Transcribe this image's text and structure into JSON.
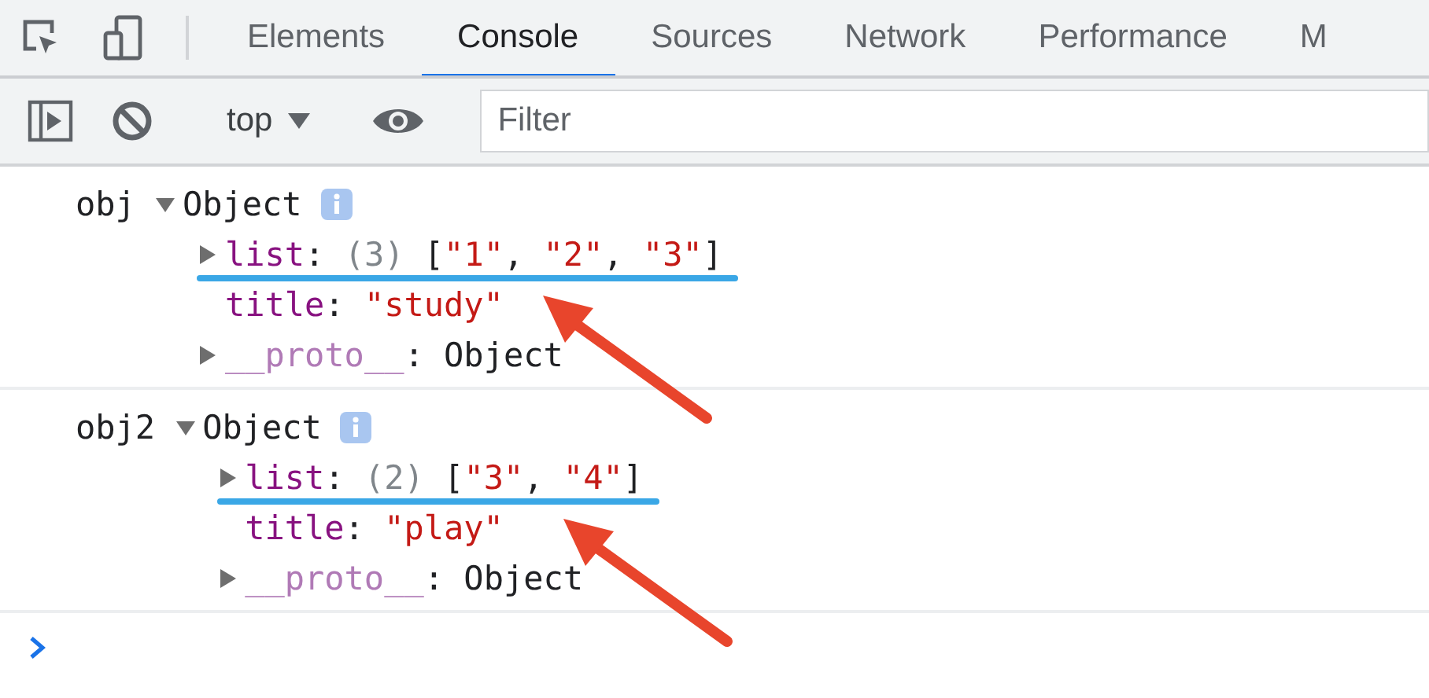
{
  "tabs": [
    {
      "label": "Elements",
      "selected": false
    },
    {
      "label": "Console",
      "selected": true
    },
    {
      "label": "Sources",
      "selected": false
    },
    {
      "label": "Network",
      "selected": false
    },
    {
      "label": "Performance",
      "selected": false
    },
    {
      "label": "M",
      "selected": false
    }
  ],
  "console_toolbar": {
    "context": "top",
    "filter": {
      "placeholder": "Filter"
    }
  },
  "entries": [
    {
      "name": "obj",
      "summary": "Object",
      "expanded": true,
      "properties": [
        {
          "expandable": true,
          "underlined": true,
          "arrow": false,
          "tokens": [
            {
              "text": "list",
              "kind": "key"
            },
            {
              "text": ": ",
              "kind": "punct"
            },
            {
              "text": "(3) ",
              "kind": "count"
            },
            {
              "text": "[",
              "kind": "punct"
            },
            {
              "text": "\"1\"",
              "kind": "string"
            },
            {
              "text": ", ",
              "kind": "punct"
            },
            {
              "text": "\"2\"",
              "kind": "string"
            },
            {
              "text": ", ",
              "kind": "punct"
            },
            {
              "text": "\"3\"",
              "kind": "string"
            },
            {
              "text": "]",
              "kind": "punct"
            }
          ]
        },
        {
          "expandable": false,
          "underlined": false,
          "arrow": true,
          "tokens": [
            {
              "text": "title",
              "kind": "key"
            },
            {
              "text": ": ",
              "kind": "punct"
            },
            {
              "text": "\"study\"",
              "kind": "string"
            }
          ]
        },
        {
          "expandable": true,
          "underlined": false,
          "arrow": false,
          "tokens": [
            {
              "text": "__proto__",
              "kind": "proto"
            },
            {
              "text": ": ",
              "kind": "punct"
            },
            {
              "text": "Object",
              "kind": "plain"
            }
          ]
        }
      ]
    },
    {
      "name": "obj2",
      "summary": "Object",
      "expanded": true,
      "properties": [
        {
          "expandable": true,
          "underlined": true,
          "arrow": false,
          "tokens": [
            {
              "text": "list",
              "kind": "key"
            },
            {
              "text": ": ",
              "kind": "punct"
            },
            {
              "text": "(2) ",
              "kind": "count"
            },
            {
              "text": "[",
              "kind": "punct"
            },
            {
              "text": "\"3\"",
              "kind": "string"
            },
            {
              "text": ", ",
              "kind": "punct"
            },
            {
              "text": "\"4\"",
              "kind": "string"
            },
            {
              "text": "]",
              "kind": "punct"
            }
          ]
        },
        {
          "expandable": false,
          "underlined": false,
          "arrow": true,
          "tokens": [
            {
              "text": "title",
              "kind": "key"
            },
            {
              "text": ": ",
              "kind": "punct"
            },
            {
              "text": "\"play\"",
              "kind": "string"
            }
          ]
        },
        {
          "expandable": true,
          "underlined": false,
          "arrow": false,
          "tokens": [
            {
              "text": "__proto__",
              "kind": "proto"
            },
            {
              "text": ": ",
              "kind": "punct"
            },
            {
              "text": "Object",
              "kind": "plain"
            }
          ]
        }
      ]
    }
  ]
}
